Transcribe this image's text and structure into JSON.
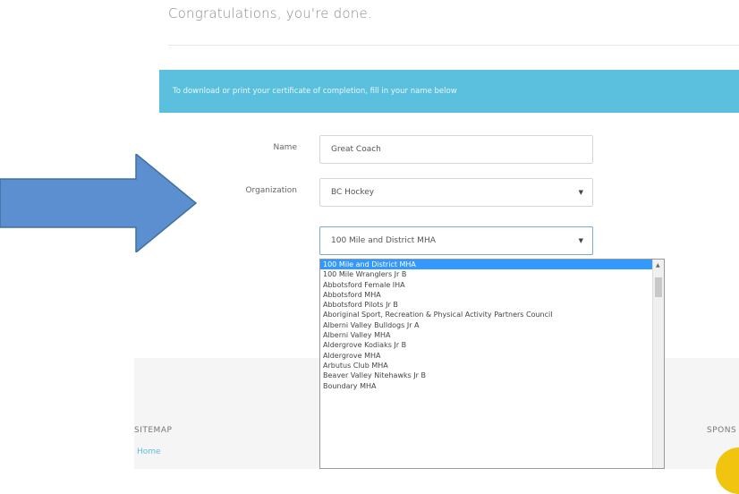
{
  "page": {
    "heading": "Congratulations, you're done.",
    "banner": "To download or print your certificate of completion, fill in your name below"
  },
  "form": {
    "name_label": "Name",
    "name_value": "Great Coach",
    "org_label": "Organization",
    "org_value": "BC Hockey",
    "team_value": "100 Mile and District MHA"
  },
  "dropdown": {
    "options": [
      "100 Mile and District MHA",
      "100 Mile Wranglers Jr B",
      "Abbotsford Female IHA",
      "Abbotsford MHA",
      "Abbotsford Pilots Jr B",
      "Aboriginal Sport, Recreation & Physical Activity Partners Council",
      "Alberni Valley Bulldogs Jr A",
      "Alberni Valley MHA",
      "Aldergrove Kodiaks Jr B",
      "Aldergrove MHA",
      "Arbutus Club MHA",
      "Beaver Valley Nitehawks Jr B",
      "Boundary MHA"
    ],
    "selected_index": 0
  },
  "footer": {
    "sitemap": "SITEMAP",
    "home": "Home",
    "sponsors": "SPONS"
  },
  "colors": {
    "banner": "#5bc0de",
    "arrow": "#5b8fd0",
    "selected": "#3399ff"
  }
}
